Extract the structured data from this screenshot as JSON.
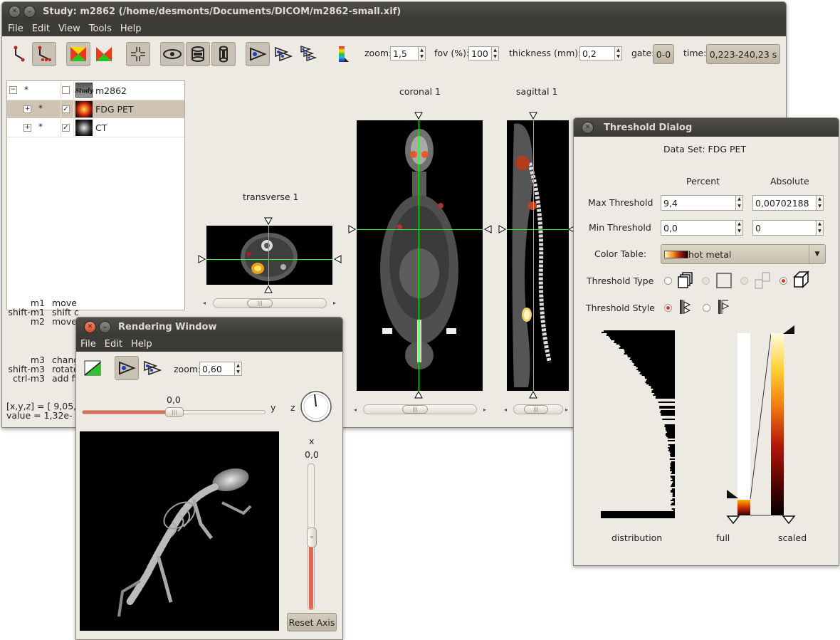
{
  "main_window": {
    "title": "Study: m2862 (/home/desmonts/Documents/DICOM/m2862-small.xif)",
    "menu": [
      "File",
      "Edit",
      "View",
      "Tools",
      "Help"
    ],
    "toolbar": {
      "zoom_label": "zoom:",
      "zoom_value": "1,5",
      "fov_label": "fov (%):",
      "fov_value": "100",
      "thickness_label": "thickness (mm):",
      "thickness_value": "0,2",
      "gate_label": "gate:",
      "gate_value": "0-0",
      "time_label": "time:",
      "time_value": "0,223-240,23 s"
    },
    "tree": [
      {
        "expander": "−",
        "star": "*",
        "checked": false,
        "icon": "study-icon",
        "name": "m2862"
      },
      {
        "expander": "+",
        "star": "*",
        "checked": true,
        "icon": "pet-thumbnail-icon",
        "name": "FDG PET"
      },
      {
        "expander": "+",
        "star": "*",
        "checked": true,
        "icon": "ct-thumbnail-icon",
        "name": "CT"
      }
    ],
    "mouse_help": {
      "keys": [
        "m1",
        "shift-m1",
        "m2",
        "m3",
        "shift-m3",
        "ctrl-m3"
      ],
      "actions": [
        "move",
        "shift c",
        "move",
        "chang",
        "rotate",
        "add fi"
      ]
    },
    "coords": {
      "xyz": "[x,y,z] = [ 9,05,",
      "value": "value  =  1,32e-"
    },
    "views": {
      "transverse": "transverse 1",
      "coronal": "coronal 1",
      "sagittal": "sagittal 1"
    }
  },
  "rendering_window": {
    "title": "Rendering Window",
    "menu": [
      "File",
      "Edit",
      "Help"
    ],
    "zoom_label": "zoom:",
    "zoom_value": "0,60",
    "y_label": "y",
    "y_value": "0,0",
    "y_slider_fraction": 0.5,
    "z_label": "z",
    "x_label": "x",
    "x_value": "0,0",
    "x_slider_fraction": 0.5,
    "reset_button": "Reset Axis"
  },
  "threshold_dialog": {
    "title": "Threshold Dialog",
    "data_set": "Data Set: FDG PET",
    "percent_header": "Percent",
    "absolute_header": "Absolute",
    "max_label": "Max Threshold",
    "max_percent": "9,4",
    "max_absolute": "0,00702188",
    "min_label": "Min Threshold",
    "min_percent": "0,0",
    "min_absolute": "0",
    "color_table_label": "Color Table:",
    "color_table_value": "hot metal",
    "threshold_type_label": "Threshold Type",
    "threshold_style_label": "Threshold Style",
    "distribution_label": "distribution",
    "full_label": "full",
    "scaled_label": "scaled"
  }
}
